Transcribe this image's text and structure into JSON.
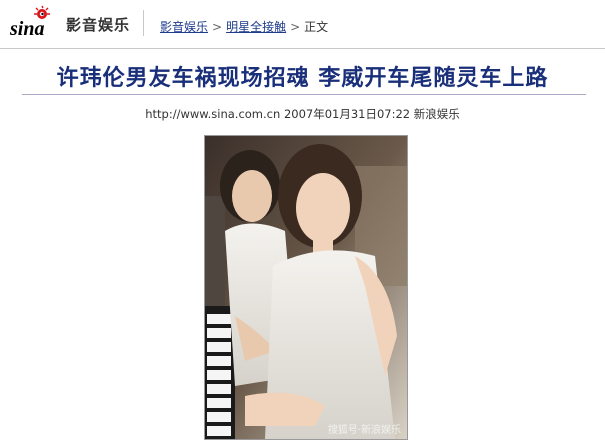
{
  "brand": {
    "logo_text": "sina",
    "channel": "影音娱乐"
  },
  "breadcrumb": {
    "items": [
      "影音娱乐",
      "明星全接触"
    ],
    "current": "正文",
    "separator": ">"
  },
  "article": {
    "headline": "许玮伦男友车祸现场招魂 李威开车尾随灵车上路",
    "source_url": "http://www.sina.com.cn",
    "datetime": "2007年01月31日07:22",
    "source_name": "新浪娱乐"
  },
  "photo": {
    "alt": "",
    "watermark": "搜狐号·新浪娱乐"
  },
  "colors": {
    "headline": "#1a2f7a",
    "link": "#1f3c8c",
    "logo_red": "#d9141b"
  }
}
